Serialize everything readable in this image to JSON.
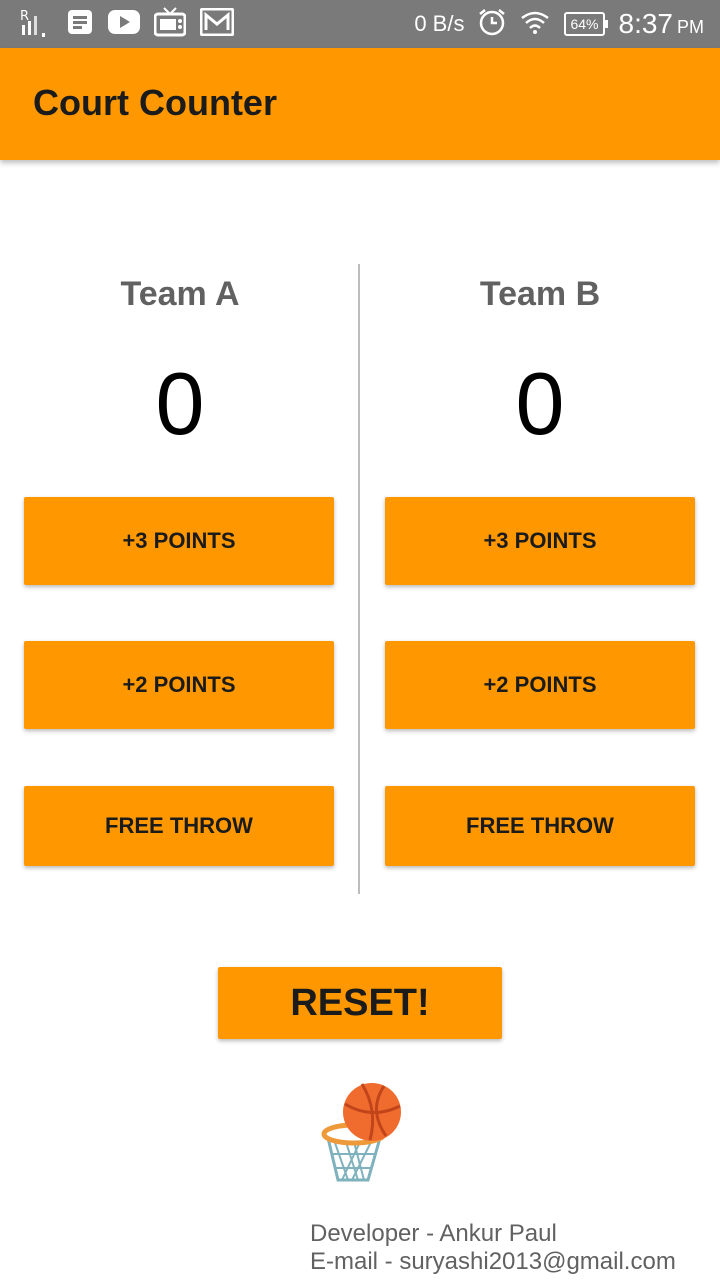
{
  "status_bar": {
    "network_speed": "0 B/s",
    "battery": "64%",
    "time": "8:37",
    "ampm": "PM"
  },
  "app": {
    "title": "Court Counter"
  },
  "team_a": {
    "name": "Team A",
    "score": "0",
    "btn_three": "+3 POINTS",
    "btn_two": "+2 POINTS",
    "btn_free": "FREE THROW"
  },
  "team_b": {
    "name": "Team B",
    "score": "0",
    "btn_three": "+3 POINTS",
    "btn_two": "+2 POINTS",
    "btn_free": "FREE THROW"
  },
  "reset_label": "RESET!",
  "footer": {
    "developer": "Developer - Ankur Paul",
    "email": "E-mail -  suryashi2013@gmail.com"
  },
  "colors": {
    "accent": "#ff9800",
    "status_bar": "#7a7a7a"
  },
  "icons": [
    "signal-icon",
    "notes-icon",
    "youtube-icon",
    "tv-icon",
    "gmail-icon",
    "alarm-icon",
    "wifi-icon",
    "battery-icon",
    "basketball-hoop-icon"
  ]
}
